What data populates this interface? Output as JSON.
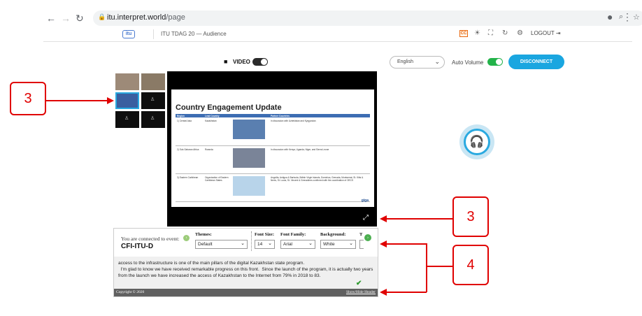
{
  "browser": {
    "back_icon": "arrow-left-icon",
    "url_host": "itu.interpret.world",
    "url_path": "/page"
  },
  "app_header": {
    "logo_text": "itu",
    "title": "ITU TDAG 20 — Audience",
    "cc_label": "CC",
    "logout_label": "LOGOUT"
  },
  "controls": {
    "video_label": "VIDEO",
    "language": "English",
    "auto_volume_label": "Auto Volume",
    "disconnect_label": "DISCONNECT"
  },
  "slide": {
    "title": "Country Engagement Update",
    "columns": [
      "Region",
      "Lead Country",
      "",
      "Partner Countries"
    ],
    "rows": [
      {
        "region": "1) Central Asia",
        "lead": "Kazakhstan",
        "partners": "In discussion with Uzbekistan and Kyrgyzstan"
      },
      {
        "region": "2) Sub-Saharan Africa",
        "lead": "Rwanda",
        "partners": "In discussion with Kenya, Uganda, Niger, and Sierra Leone"
      },
      {
        "region": "3) Eastern Caribbean",
        "lead": "Organization of Eastern Caribbean States",
        "partners": "Anguilla, Antigua & Barbuda, British Virgin Islands, Dominica, Grenada, Montserrat, St. Kitts & Nevis, St. Lucia, St. Vincent & Grenadines confirmed with the coordination of OECS"
      }
    ],
    "logo_text": "giga"
  },
  "captions": {
    "connected_label": "You are connected to event:",
    "event_name": "CFI-ITU-D",
    "options": {
      "themes_label": "Themes:",
      "themes_value": "Default",
      "font_size_label": "Font Size:",
      "font_size_value": "14",
      "font_family_label": "Font Family:",
      "font_family_value": "Arial",
      "background_label": "Background:",
      "background_value": "White",
      "text_label": "T"
    },
    "line1": "access to the infrastructure is one of the main pillars of the digital Kazakhstan state program.",
    "line2": "  I'm glad to know we have received remarkable progress on this front.  Since the launch of the program, it is actually two years from the launch we have increased the access of Kazakhstan to the Internet from 79% in 2018 to 83.",
    "copyright": "Copyright © 2020",
    "show_hide_label": "Show/Hide Header"
  },
  "callouts": {
    "left": "3",
    "right_top": "3",
    "right_bottom": "4"
  },
  "colors": {
    "accent_blue": "#1aa6e0",
    "toggle_green": "#23b34a",
    "callout_red": "#e00000"
  }
}
